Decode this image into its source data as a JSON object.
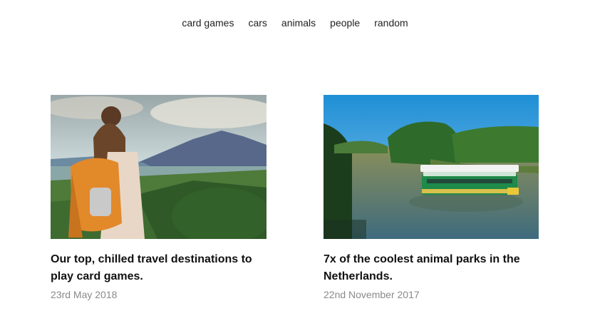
{
  "nav": {
    "items": [
      {
        "label": "card games"
      },
      {
        "label": "cars"
      },
      {
        "label": "animals"
      },
      {
        "label": "people"
      },
      {
        "label": "random"
      }
    ]
  },
  "posts": [
    {
      "title": "Our top, chilled travel destinations to play card games.",
      "date": "23rd May 2018",
      "image_subject": "hiker-overlooking-volcano"
    },
    {
      "title": "7x of the coolest animal parks in the Netherlands.",
      "date": "22nd November 2017",
      "image_subject": "tour-boat-on-river"
    }
  ]
}
